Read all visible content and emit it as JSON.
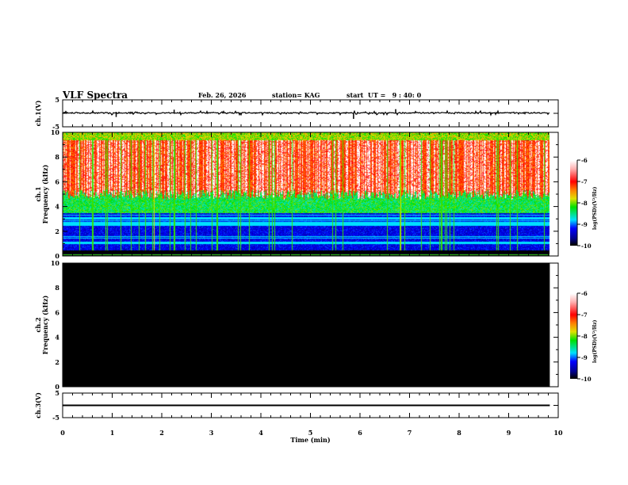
{
  "header": {
    "title": "VLF Spectra",
    "date": "Feb. 26, 2026",
    "station": "station= KAG",
    "start_ut": "start  UT =   9 : 40: 0"
  },
  "chart_data": [
    {
      "type": "line",
      "panel": "ch1-waveform",
      "ylabel": "ch.1(V)",
      "ylim": [
        -5,
        5
      ],
      "yticks": [
        "5",
        "-5"
      ],
      "xlim": [
        0,
        10
      ],
      "data_end_min": 9.83,
      "baseline_v": 0,
      "spikes": [
        {
          "x": 1.08,
          "y": -1.5
        },
        {
          "x": 2.25,
          "y": 1.2
        },
        {
          "x": 5.87,
          "y": -2.2
        },
        {
          "x": 6.72,
          "y": 1.4
        }
      ]
    },
    {
      "type": "heatmap",
      "panel": "ch1-spectrogram",
      "ylabel": "ch.1\nFrequency (kHz)",
      "ylim": [
        0,
        10
      ],
      "yticks": [
        "0",
        "2",
        "4",
        "6",
        "8",
        "10"
      ],
      "xlim": [
        0,
        10
      ],
      "colorbar": {
        "label": "log(PSD)(V²/Hz)",
        "range": [
          -10,
          -6
        ],
        "ticks": [
          "-6",
          "-7",
          "-8",
          "-9",
          "-10"
        ]
      }
    },
    {
      "type": "heatmap",
      "panel": "ch2-spectrogram",
      "ylabel": "ch.2\nFrequency (kHz)",
      "ylim": [
        0,
        10
      ],
      "yticks": [
        "0",
        "2",
        "4",
        "6",
        "8",
        "10"
      ],
      "xlim": [
        0,
        10
      ],
      "fill_value": -10,
      "colorbar": {
        "label": "log(PSD)(V²/Hz)",
        "range": [
          -10,
          -6
        ],
        "ticks": [
          "-6",
          "-7",
          "-8",
          "-9",
          "-10"
        ]
      }
    },
    {
      "type": "line",
      "panel": "ch3-waveform",
      "ylabel": "ch.3(V)",
      "ylim": [
        -5,
        5
      ],
      "yticks": [
        "5",
        "-5"
      ],
      "xlim": [
        0,
        10
      ],
      "baseline_v": 0,
      "xlabel": "Time  (min)",
      "xticks": [
        "0",
        "1",
        "2",
        "3",
        "4",
        "5",
        "6",
        "7",
        "8",
        "9",
        "10"
      ]
    }
  ],
  "colors": {
    "colormap": [
      "#000000",
      "#00008c",
      "#0000ff",
      "#00e0ff",
      "#00e000",
      "#e0e000",
      "#ff8000",
      "#ff0000",
      "#ffb0b0",
      "#ffffff"
    ]
  }
}
